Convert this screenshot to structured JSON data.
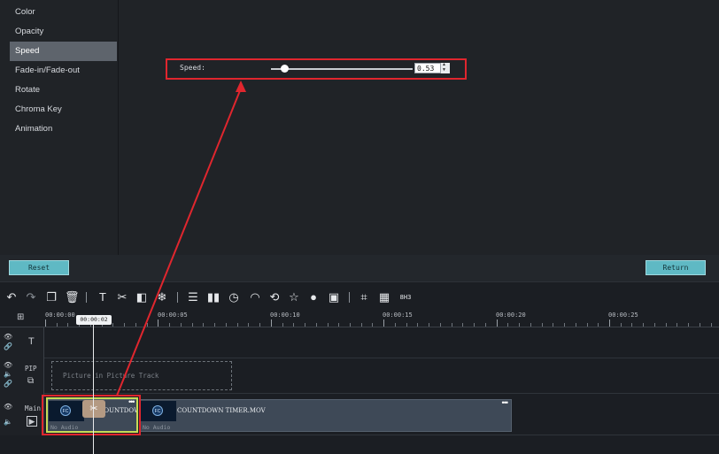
{
  "menu": {
    "items": [
      "Color",
      "Opacity",
      "Speed",
      "Fade-in/Fade-out",
      "Rotate",
      "Chroma Key",
      "Animation"
    ],
    "active": "Speed"
  },
  "speed": {
    "label": "Speed:",
    "value": "0.53"
  },
  "buttons": {
    "reset": "Reset",
    "return": "Return"
  },
  "toolbar": {
    "icons": [
      "undo-icon",
      "redo-icon",
      "copy-icon",
      "delete-icon",
      "text-icon",
      "cut-icon",
      "split-icon",
      "freeze-icon",
      "settings-icon",
      "audio-icon",
      "duration-icon",
      "speed-icon",
      "reverse-icon",
      "effects-icon",
      "user-icon",
      "record-icon",
      "crop-icon",
      "mosaic-icon"
    ],
    "zoom_label": "8H3"
  },
  "ruler": {
    "labels": [
      "00:00:00",
      "00:00:05",
      "00:00:10",
      "00:00:15",
      "00:00:20",
      "00:00:25"
    ],
    "playhead": "00:00:02"
  },
  "tracks": {
    "text_label": "T",
    "pip_label": "PIP",
    "pip_placeholder": "Picture in Picture Track",
    "main_label": "Main"
  },
  "clips": [
    {
      "name": "COUNTDOWN TIM",
      "audio": "No Audio"
    },
    {
      "name": "COUNTDOWN TIMER.MOV",
      "audio": "No Audio"
    }
  ],
  "colors": {
    "accent_teal": "#5fb9c4",
    "highlight_red": "#e0262e",
    "selection_yellow": "#c6dc57"
  }
}
